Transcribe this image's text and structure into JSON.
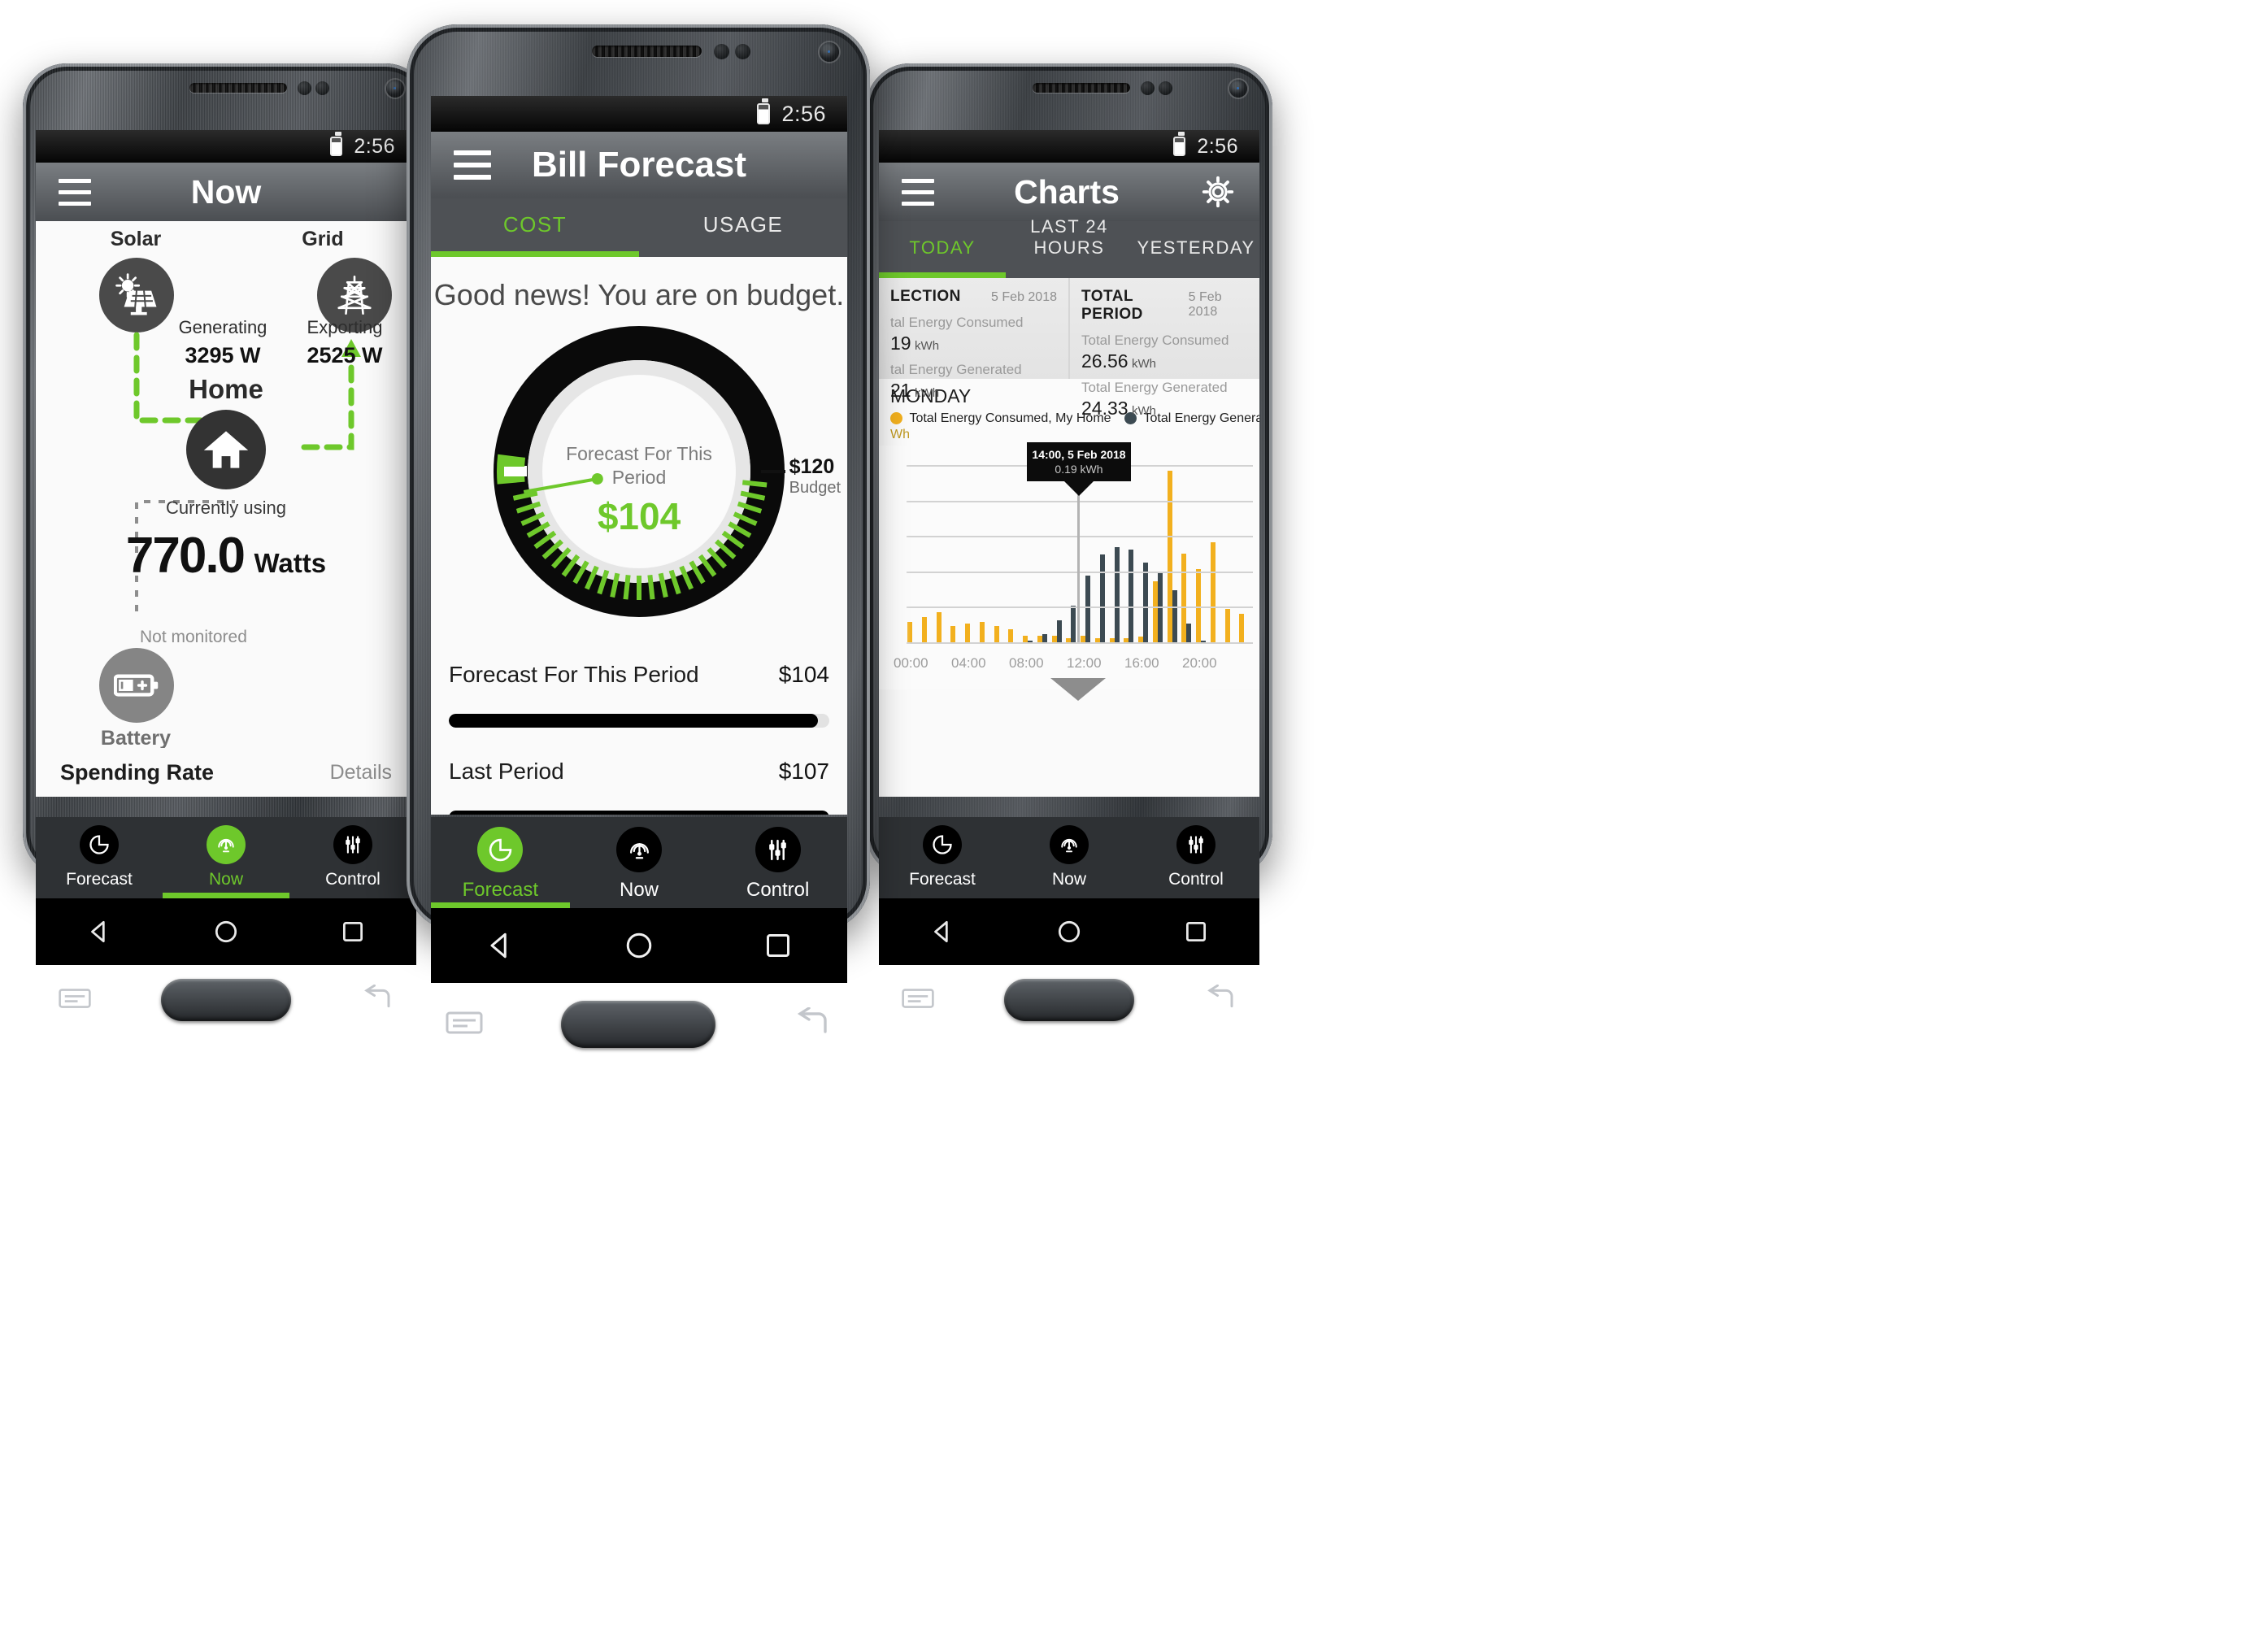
{
  "app": {
    "accent": "#6ec82b",
    "amber": "#f2b01e",
    "slate": "#3c4a52"
  },
  "phones": {
    "left": {
      "status": {
        "time": "2:56"
      },
      "appbar": {
        "title": "Now",
        "menu_icon": "hamburger-icon"
      },
      "nodes": {
        "solar_label": "Solar",
        "grid_label": "Grid",
        "home_label": "Home",
        "battery_label": "Battery"
      },
      "flows": {
        "generating_label": "Generating",
        "generating_value": "3295 W",
        "exporting_label": "Exporting",
        "exporting_value": "2525 W",
        "battery_note": "Not monitored"
      },
      "usage": {
        "label": "Currently using",
        "value": "770.0",
        "unit": "Watts"
      },
      "spending": {
        "label": "Spending Rate",
        "action": "Details"
      },
      "bottomnav": [
        {
          "label": "Forecast",
          "icon": "pie-chart-icon",
          "active": false
        },
        {
          "label": "Now",
          "icon": "gauge-icon",
          "active": true
        },
        {
          "label": "Control",
          "icon": "sliders-icon",
          "active": false
        }
      ]
    },
    "middle": {
      "status": {
        "time": "2:56"
      },
      "appbar": {
        "title": "Bill Forecast",
        "menu_icon": "hamburger-icon"
      },
      "tabs": [
        {
          "label": "COST",
          "active": true
        },
        {
          "label": "USAGE",
          "active": false
        }
      ],
      "headline": "Good news! You are on budget.",
      "gauge": {
        "center_label": "Forecast For This Period",
        "center_value": "$104",
        "budget_value": "$120",
        "budget_label": "Budget",
        "percent": 87
      },
      "rows": [
        {
          "name": "Forecast For This Period",
          "value": "$104",
          "fill": 97
        },
        {
          "name": "Last Period",
          "value": "$107",
          "fill": 100
        }
      ],
      "bottomnav": [
        {
          "label": "Forecast",
          "icon": "pie-chart-icon",
          "active": true
        },
        {
          "label": "Now",
          "icon": "gauge-icon",
          "active": false
        },
        {
          "label": "Control",
          "icon": "sliders-icon",
          "active": false
        }
      ]
    },
    "right": {
      "status": {
        "time": "2:56"
      },
      "appbar": {
        "title": "Charts",
        "menu_icon": "hamburger-icon",
        "settings_icon": "gear-icon"
      },
      "tabs": [
        {
          "label": "TODAY",
          "active": true
        },
        {
          "label": "LAST 24 HOURS",
          "active": false
        },
        {
          "label": "YESTERDAY",
          "active": false
        }
      ],
      "cards": [
        {
          "title": "LECTION",
          "date": "5 Feb 2018",
          "metrics": [
            {
              "label": "tal Energy Consumed",
              "value": "19",
              "unit": "kWh"
            },
            {
              "label": "tal Energy Generated",
              "value": "21",
              "unit": "kWh"
            }
          ]
        },
        {
          "title": "TOTAL PERIOD",
          "date": "5 Feb 2018",
          "metrics": [
            {
              "label": "Total Energy Consumed",
              "value": "26.56",
              "unit": "kWh"
            },
            {
              "label": "Total Energy Generated",
              "value": "24.33",
              "unit": "kWh"
            }
          ]
        }
      ],
      "chart_header": {
        "day": "MONDAY",
        "yaxis_unit": "Wh"
      },
      "legend": [
        {
          "label": "Total Energy Consumed, My Home",
          "color": "#f2b01e"
        },
        {
          "label": "Total Energy Generated, Solar Panels",
          "color": "#3c4a52"
        }
      ],
      "tooltip": {
        "title": "14:00, 5 Feb 2018",
        "value": "0.19 kWh"
      },
      "bottomnav": [
        {
          "label": "Forecast",
          "icon": "pie-chart-icon",
          "active": false
        },
        {
          "label": "Now",
          "icon": "gauge-icon",
          "active": false
        },
        {
          "label": "Control",
          "icon": "sliders-icon",
          "active": false
        }
      ]
    }
  },
  "chart_data": {
    "type": "bar",
    "title": "MONDAY",
    "xlabel": "",
    "ylabel": "kWh",
    "grid": true,
    "legend_position": "top",
    "xticks": [
      "00:00",
      "04:00",
      "08:00",
      "12:00",
      "16:00",
      "20:00"
    ],
    "x": [
      "00:00",
      "01:00",
      "02:00",
      "03:00",
      "04:00",
      "05:00",
      "06:00",
      "07:00",
      "08:00",
      "09:00",
      "10:00",
      "11:00",
      "12:00",
      "13:00",
      "14:00",
      "15:00",
      "16:00",
      "17:00",
      "18:00",
      "19:00",
      "20:00",
      "21:00",
      "22:00",
      "23:00"
    ],
    "ylim": [
      0,
      1.6
    ],
    "series": [
      {
        "name": "Total Energy Consumed, My Home",
        "color": "#f2b01e",
        "values": [
          0.18,
          0.23,
          0.27,
          0.15,
          0.17,
          0.18,
          0.15,
          0.12,
          0.06,
          0.06,
          0.06,
          0.04,
          0.06,
          0.04,
          0.04,
          0.04,
          0.05,
          0.55,
          1.55,
          0.8,
          0.66,
          0.9,
          0.3,
          0.26
        ]
      },
      {
        "name": "Total Energy Generated, Solar Panels",
        "color": "#3c4a52",
        "values": [
          0,
          0,
          0,
          0,
          0,
          0,
          0,
          0,
          0.01,
          0.07,
          0.2,
          0.33,
          0.6,
          0.79,
          0.86,
          0.84,
          0.72,
          0.63,
          0.47,
          0.17,
          0.01,
          0,
          0,
          0
        ]
      }
    ],
    "annotation": {
      "x": "14:00",
      "label": "14:00, 5 Feb 2018",
      "value": "0.19 kWh"
    }
  }
}
